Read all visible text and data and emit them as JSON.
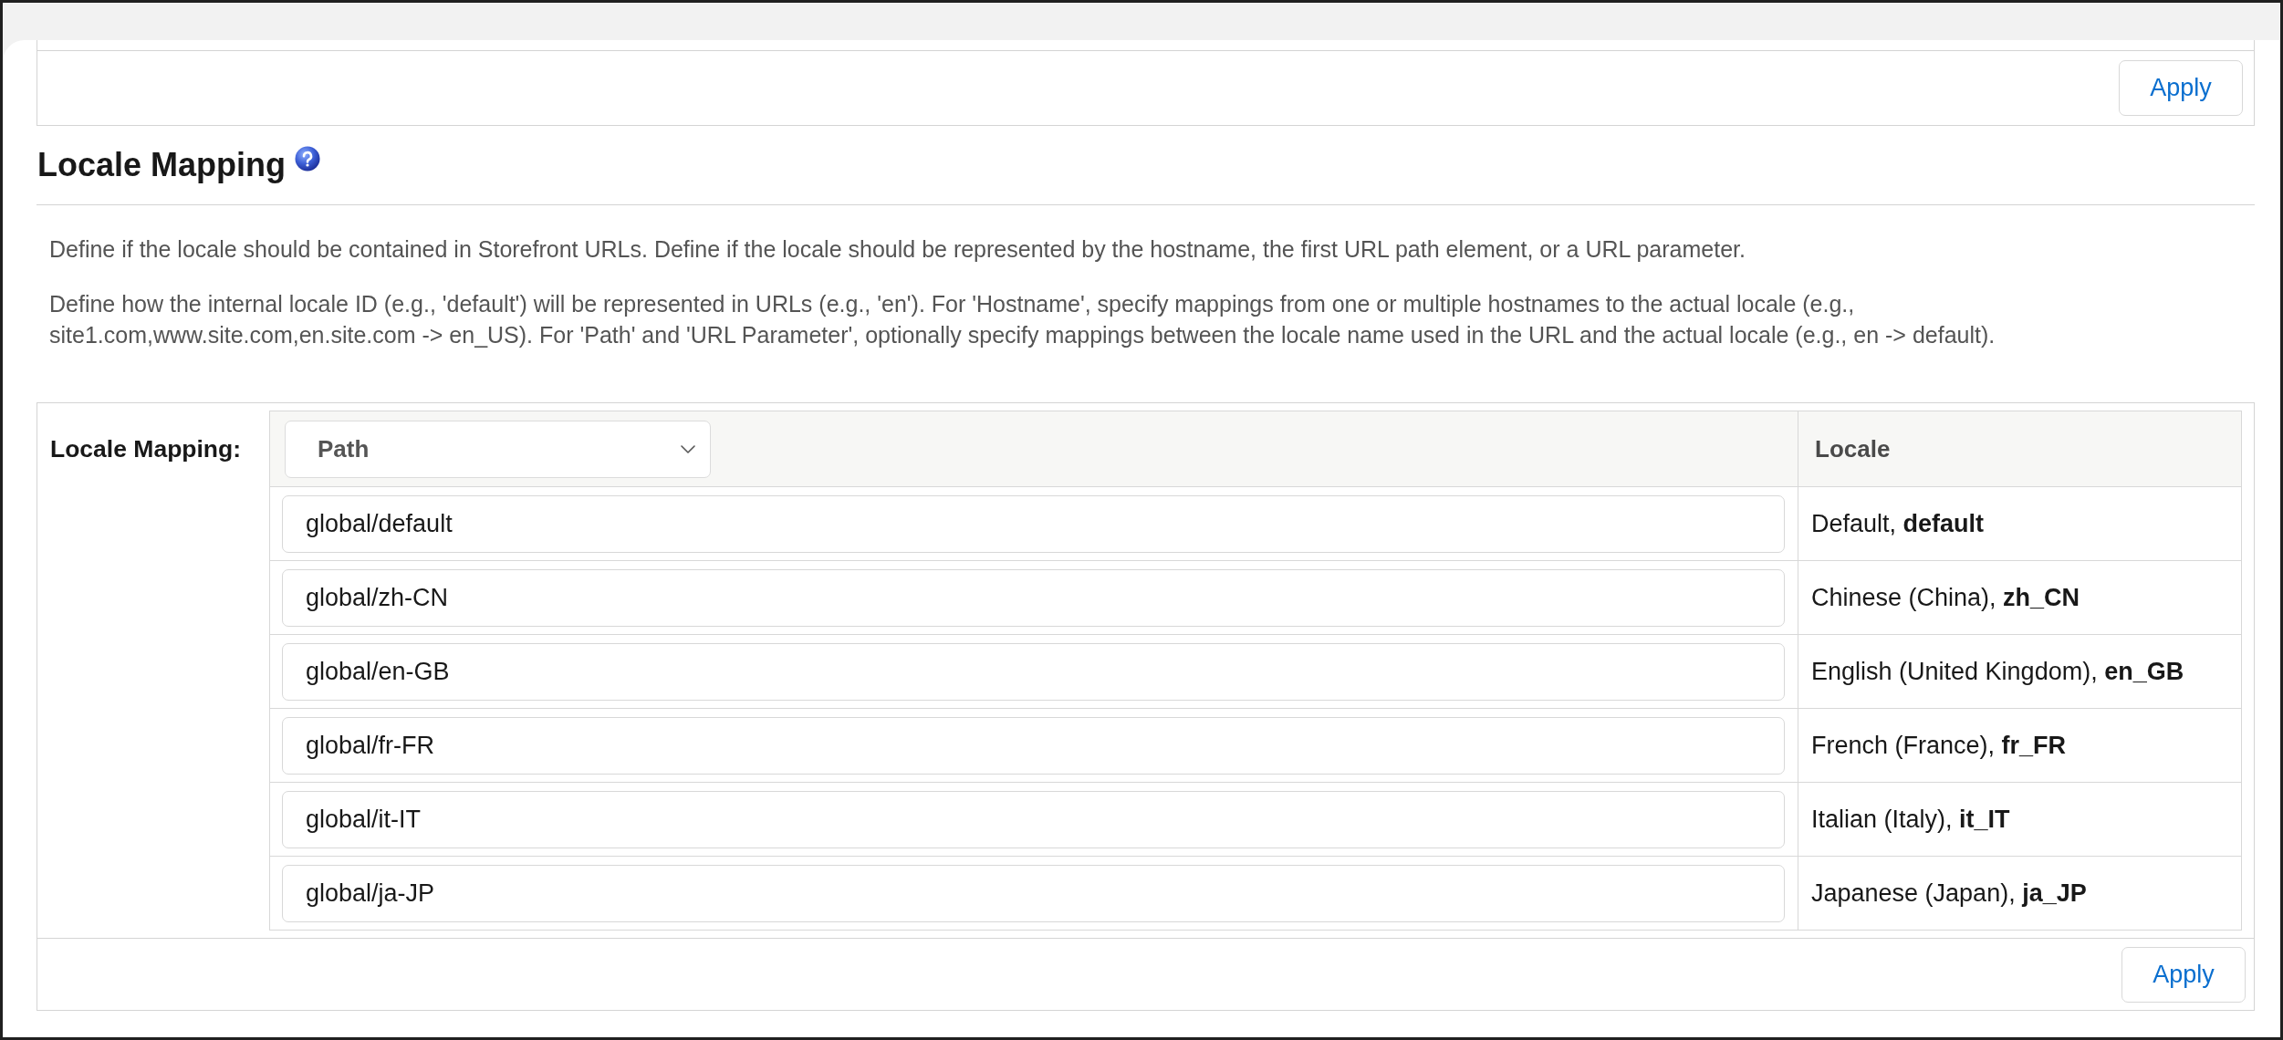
{
  "top_panel": {
    "apply_button": "Apply"
  },
  "section": {
    "title": "Locale Mapping",
    "description": [
      "Define if the locale should be contained in Storefront URLs. Define if the locale should be represented by the hostname, the first URL path element, or a URL parameter.",
      "Define how the internal locale ID (e.g., 'default') will be represented in URLs (e.g., 'en'). For 'Hostname', specify mappings from one or multiple hostnames to the actual locale (e.g., site1.com,www.site.com,en.site.com -> en_US). For 'Path' and 'URL Parameter', optionally specify mappings between the locale name used in the URL and the actual locale (e.g., en -> default)."
    ]
  },
  "mapping": {
    "label": "Locale Mapping:",
    "mode_select": {
      "value": "Path"
    },
    "locale_column": "Locale",
    "rows": [
      {
        "path": "global/default",
        "locale": "Default, **default**"
      },
      {
        "path": "global/zh-CN",
        "locale": "Chinese (China), **zh_CN**"
      },
      {
        "path": "global/en-GB",
        "locale": "English (United Kingdom), **en_GB**"
      },
      {
        "path": "global/fr-FR",
        "locale": "French (France), **fr_FR**"
      },
      {
        "path": "global/it-IT",
        "locale": "Italian (Italy), **it_IT**"
      },
      {
        "path": "global/ja-JP",
        "locale": "Japanese (Japan), **ja_JP**"
      }
    ],
    "apply_button": "Apply"
  }
}
